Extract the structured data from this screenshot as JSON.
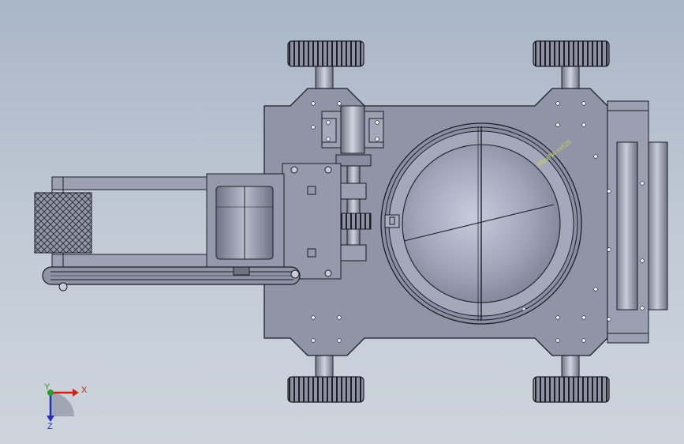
{
  "viewport": {
    "background_top": "#a9b6c7",
    "background_bottom": "#cdd4dc"
  },
  "model": {
    "body_color": "#8e93a6",
    "outline_color": "#1c1d24",
    "disc_color": "#9ea3b8",
    "engraving_text": "Mou Nu xx525",
    "engraving_color": "#d6d24a"
  },
  "triad": {
    "x_label": "X",
    "y_label": "Y",
    "z_label": "Z",
    "x_color": "#c0281c",
    "y_color": "#2f9a2f",
    "z_color": "#2230b8"
  }
}
